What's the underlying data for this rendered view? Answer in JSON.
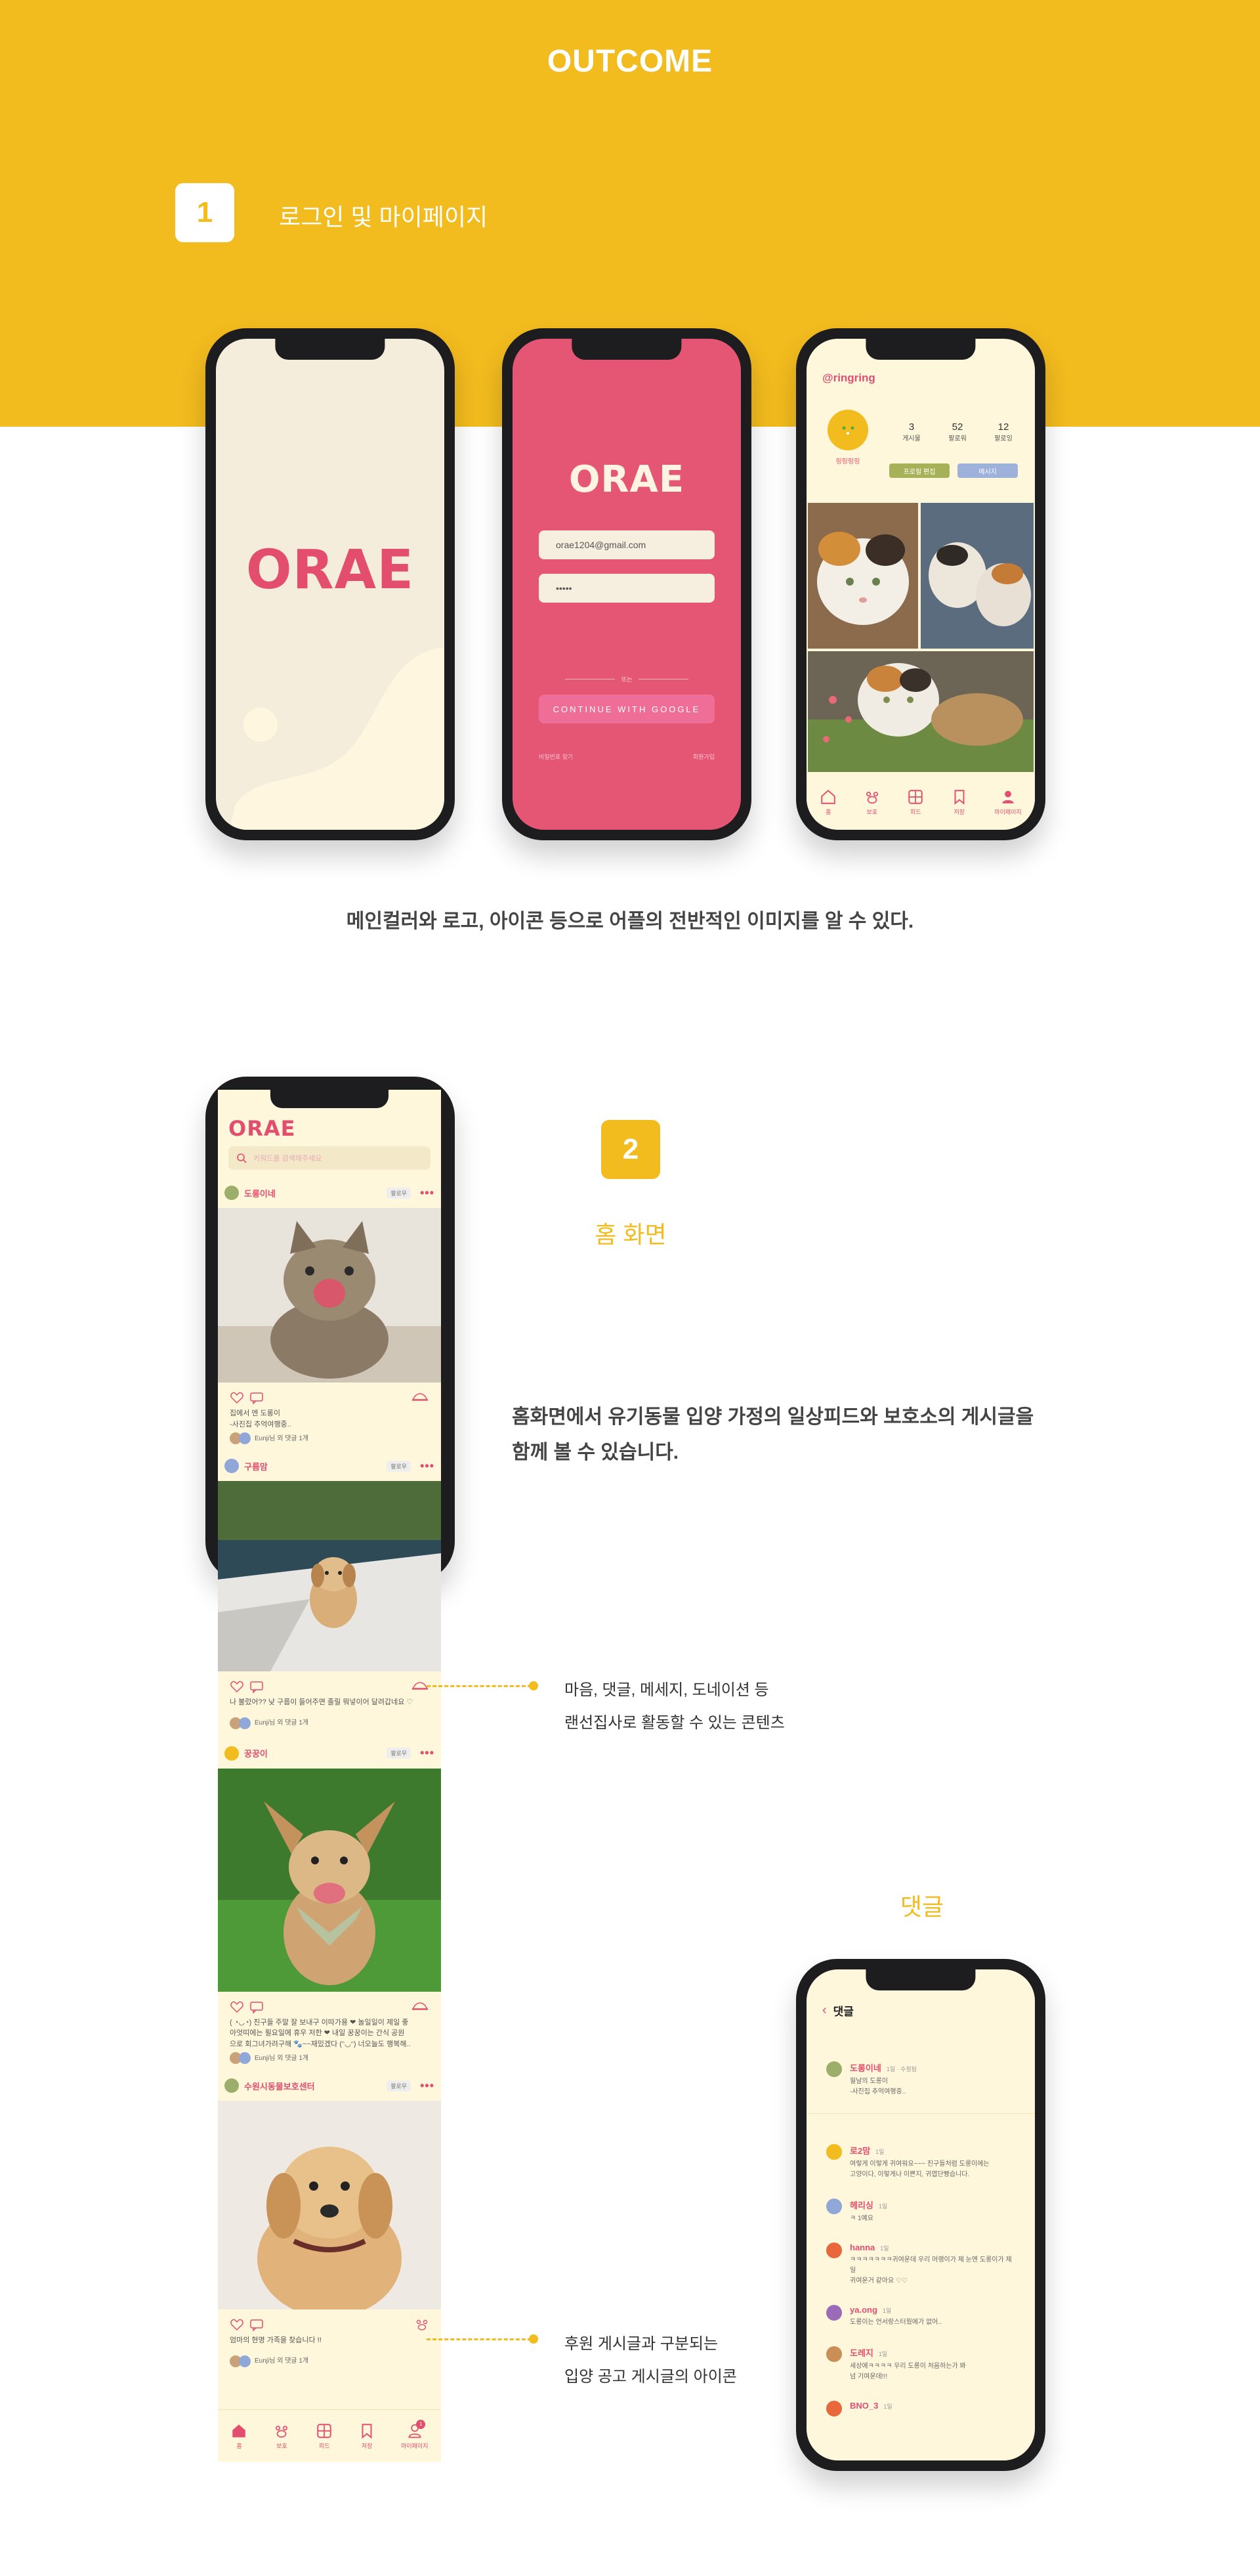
{
  "header": {
    "title": "OUTCOME"
  },
  "section1": {
    "number": "1",
    "label": "로그인 및 마이페이지",
    "caption": "메인컬러와 로고, 아이콘 등으로 어플의 전반적인 이미지를 알 수 있다."
  },
  "splash": {
    "logo": "ORAE"
  },
  "login": {
    "logo": "ORAE",
    "email_value": "orae1204@gmail.com",
    "password_value": "•••••",
    "divider_text": "또는",
    "google_button": "CONTINUE WITH GOOGLE",
    "footer_left": "비밀번호 찾기",
    "footer_right": "회원가입"
  },
  "mypage": {
    "handle": "@ringring",
    "nickname": "링링링링",
    "stats": [
      {
        "value": "3",
        "label": "게시물"
      },
      {
        "value": "52",
        "label": "팔로워"
      },
      {
        "value": "12",
        "label": "팔로잉"
      }
    ],
    "edit_button": "프로필 편집",
    "message_button": "메시지",
    "tabs": [
      "홈",
      "보호",
      "피드",
      "저장",
      "마이페이지"
    ]
  },
  "section2": {
    "number": "2",
    "label": "홈 화면",
    "description_line1": "홈화면에서 유기동물 입양 가정의 일상피드와 보호소의 게시글을",
    "description_line2": "함께 볼 수 있습니다."
  },
  "feed": {
    "logo": "ORAE",
    "search_placeholder": "키워드를 검색해주세요",
    "follow_label": "팔로우",
    "posts": [
      {
        "author": "도롱이네",
        "text1": "집에서 엔 도롱이",
        "text2": "-사진집 추억여행중..",
        "likes": "Eunji님 외 댓글 1개"
      },
      {
        "author": "구름맘",
        "text1": "나 불렀어?? 낮 구름이 들어주면 졸릴 뭐넣이어 달려갑네요 ♡",
        "text2": "",
        "likes": "Eunji님 외 댓글 1개"
      },
      {
        "author": "꿍꿍이",
        "text1": "( ◔◡◔) 친구들 주말 잘 보내구 이따가용 ❤ 놀일일이 제일 좋",
        "text2": "아엇띠에는 필요일에 휴우 저한 ❤ 내일 꿍꿍이는 간식 공원",
        "text3": "으로 회그녀가려구해 🐾~~재밌겠다 (ᵔ◡ᵔ) 너오늘도 행복해..",
        "likes": "Eunji님 외 댓글 1개"
      },
      {
        "author": "수원시동물보호센터",
        "text1": "엄마의 현명 가족을 찾습니다 !!",
        "text2": "",
        "likes": "Eunji님 외 댓글 1개"
      }
    ],
    "tabs": [
      "홈",
      "보호",
      "피드",
      "저장",
      "마이페이지"
    ],
    "badge": "1"
  },
  "callouts": {
    "actions_line1": "마음, 댓글, 메세지, 도네이션 등",
    "actions_line2": "랜선집사로 활동할 수 있는 콘텐츠",
    "adopt_line1": "후원 게시글과 구분되는",
    "adopt_line2": "입양 공고 게시글의 아이콘"
  },
  "comments_section": {
    "label": "댓글",
    "screen_title": "댓글",
    "comments": [
      {
        "name": "도롱이네",
        "time": "1일 · 수정됨",
        "text1": "월날의 도롱이",
        "text2": "-사진집 추억여행중..",
        "color": "#9BAE6A"
      },
      {
        "name": "로2맘",
        "time": "1일",
        "text1": "여렇게 이렇게 귀여워요~~~ 친구들처럼 도롱이에는",
        "text2": "고양이다, 이렇게나 이쁜지, 귀엽단빵습니다.",
        "color": "#F2BB1E"
      },
      {
        "name": "헤리싱",
        "time": "1일",
        "text1": "ㅋ 1예요",
        "text2": "",
        "color": "#8FA8D8"
      },
      {
        "name": "hanna",
        "time": "1일",
        "text1": "ㅋㅋㅋㅋㅋㅋㅋ귀여운데 우리 머랭이가 제 눈엔 도롱이가 제일",
        "text2": "귀여운거 같아요 ♡♡",
        "color": "#E8683C"
      },
      {
        "name": "ya.ong",
        "time": "1일",
        "text1": "도롱이는 언서랑스터웠에가 없어..",
        "text2": "",
        "color": "#9B6BB8"
      },
      {
        "name": "도레지",
        "time": "1일",
        "text1": "세상에ㅋㅋㅋㅋ 우리 도롱이 처음하는가 봐",
        "text2": "넘 기여운데!!!",
        "color": "#C98F56"
      },
      {
        "name": "BNO_3",
        "time": "1일",
        "text1": "",
        "text2": "",
        "color": "#E8683C"
      }
    ]
  },
  "colors": {
    "brand_yellow": "#F2BB1E",
    "brand_pink": "#E34E6E",
    "cream": "#F5EDDC"
  }
}
